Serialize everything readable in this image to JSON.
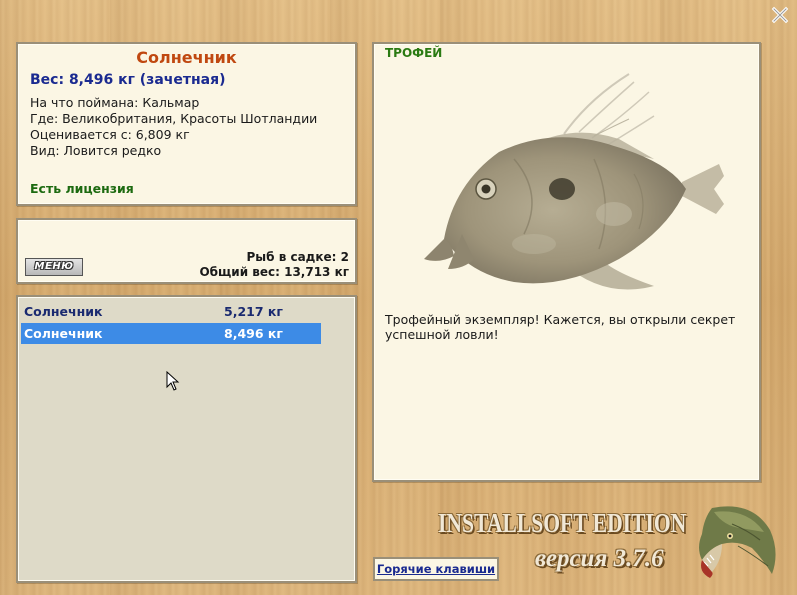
{
  "fish": {
    "name": "Солнечник",
    "weight": "Вес: 8,496 кг (зачетная)",
    "bait": "На что поймана: Кальмар",
    "location": "Где: Великобритания, Красоты Шотландии",
    "value": "Оценивается с: 6,809 кг",
    "rarity": "Вид: Ловится редко",
    "license": "Есть лицензия"
  },
  "menu": {
    "button_label": "МЕНЮ",
    "fish_count": "Рыб в садке: 2",
    "total_weight": "Общий вес: 13,713 кг"
  },
  "catch_list": [
    {
      "name": "Солнечник",
      "weight": "5,217 кг"
    },
    {
      "name": "Солнечник",
      "weight": "8,496 кг"
    }
  ],
  "selected_index": 1,
  "trophy": {
    "label": "ТРОФЕЙ",
    "description": "Трофейный экземпляр! Кажется, вы открыли секрет успешной ловли!"
  },
  "hotkeys_label": "Горячие клавиши",
  "brand": {
    "edition": "INSTALLSOFT EDITION",
    "version": "версия 3.7.6"
  },
  "icons": {
    "close": "close-icon",
    "fish_image": "john-dory-fish-image",
    "logo": "pike-fish-logo",
    "cursor": "mouse-cursor-icon"
  },
  "colors": {
    "fish_name": "#c04810",
    "weight": "#1a2a90",
    "license": "#1c6a10",
    "trophy_label": "#2a7a12",
    "selection": "#3d8be6"
  }
}
